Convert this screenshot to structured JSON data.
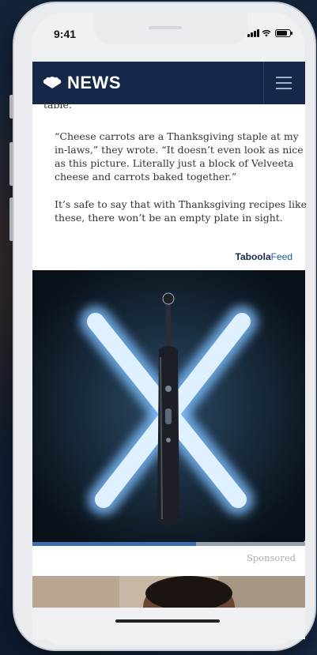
{
  "status_bar": {
    "time": "9:41"
  },
  "header": {
    "logo_text": "NEWS",
    "menu_icon": "hamburger-menu-icon"
  },
  "article": {
    "cut_text": "table.",
    "paragraph_1": "“Cheese carrots are a Thanksgiving staple at my in-laws,” they wrote. “It doesn’t even look as nice as this picture. Literally just a block of Velveeta cheese and carrots baked together.”",
    "paragraph_2": "It’s safe to say that with Thanksgiving recipes like these, there won’t be an empty plate in sight."
  },
  "taboola": {
    "brand": "Taboola",
    "label": "Feed"
  },
  "ad": {
    "progress": 0.6,
    "mute_icon": "muted-speaker-icon",
    "sponsored_label": "Sponsored"
  },
  "colors": {
    "navbar": "#16284a",
    "accent": "#1f59a8",
    "progress": "#3c6fb0",
    "neon": "#cfe9ff"
  }
}
